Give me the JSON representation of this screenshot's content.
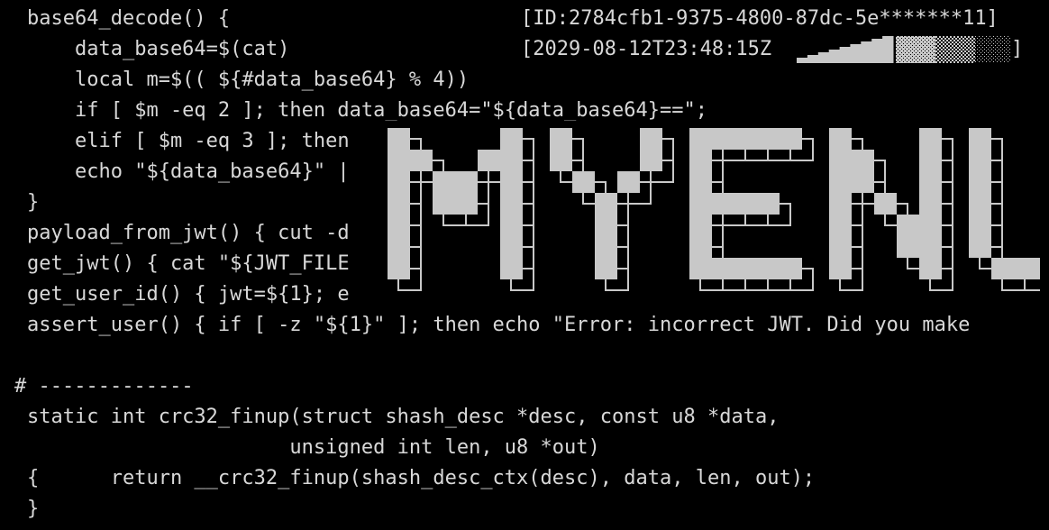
{
  "terminal": {
    "header_id": "[ID:2784cfb1-9375-4800-87dc-5e*******11]",
    "header_time": "[2029-08-12T23:48:15Z",
    "header_close": "]",
    "progress_fraction": 0.45,
    "lines": [
      "base64_decode() {",
      "    data_base64=$(cat)",
      "    local m=$(( ${#data_base64} % 4))",
      "    if [ $m -eq 2 ]; then data_base64=\"${data_base64}==\";",
      "    elif [ $m -eq 3 ]; then",
      "    echo \"${data_base64}\" |",
      "}",
      "payload_from_jwt() { cut -d",
      "get_jwt() { cat \"${JWT_FILE",
      "get_user_id() { jwt=${1}; e",
      "assert_user() { if [ -z \"${1}\" ]; then echo \"Error: incorrect JWT. Did you make",
      "",
      "# -------------",
      "static int crc32_finup(struct shash_desc *desc, const u8 *data,",
      "                      unsigned int len, u8 *out)",
      "{      return __crc32_finup(shash_desc_ctx(desc), data, len, out);",
      "}"
    ],
    "banner_text": "MYENU",
    "colors": {
      "background": "#000000",
      "text": "#d8d8d8",
      "banner_fill": "#c8c8c8"
    }
  }
}
